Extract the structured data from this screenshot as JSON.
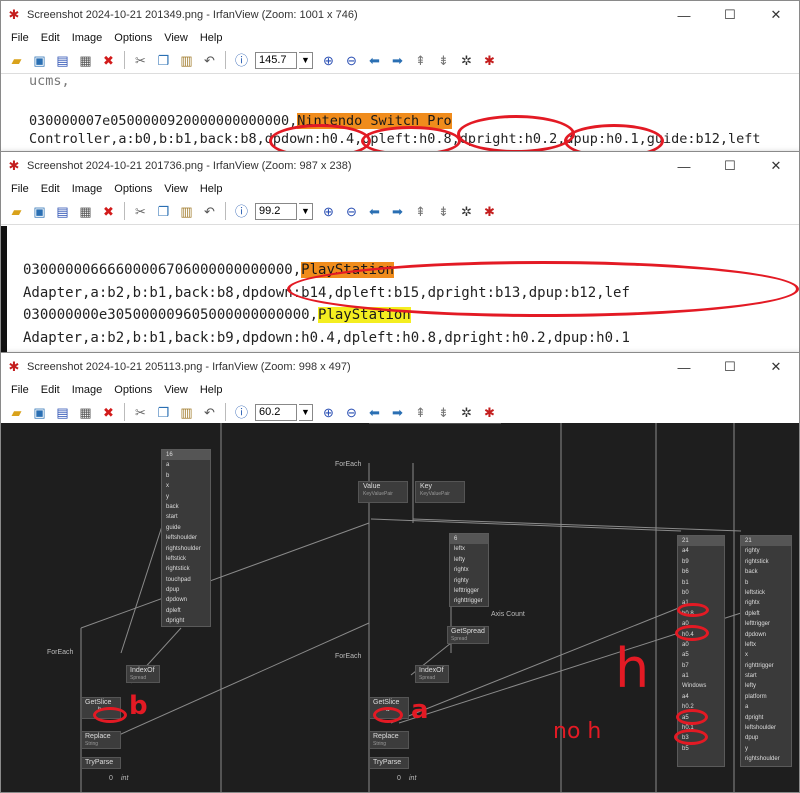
{
  "windows": [
    {
      "title": "Screenshot 2024-10-21 201349.png - IrfanView (Zoom: 1001 x 746)",
      "menu": [
        "File",
        "Edit",
        "Image",
        "Options",
        "View",
        "Help"
      ],
      "zoom": "145.7",
      "code": {
        "line0": "ucms,",
        "line1_pre": "030000007e0500000920000000000000,",
        "line1_hl": "Nintendo Switch Pro",
        "line2": "Controller,a:b0,b:b1,back:b8,dpdown:h0.4,dpleft:h0.8,dpright:h0.2,dpup:h0.1,guide:b12,left"
      }
    },
    {
      "title": "Screenshot 2024-10-21 201736.png - IrfanView (Zoom: 987 x 238)",
      "menu": [
        "File",
        "Edit",
        "Image",
        "Options",
        "View",
        "Help"
      ],
      "zoom": "99.2",
      "code": {
        "line1_pre": "03000000666600006706000000000000,",
        "line1_hl": "PlayStation",
        "line2": "Adapter,a:b2,b:b1,back:b8,dpdown:b14,dpleft:b15,dpright:b13,dpup:b12,lef",
        "line3_pre": "030000000e305000009605000000000000,",
        "line3_hl": "PlayStation",
        "line4": "Adapter,a:b2,b:b1,back:b9,dpdown:h0.4,dpleft:h0.8,dpright:h0.2,dpup:h0.1"
      }
    },
    {
      "title": "Screenshot 2024-10-21 205113.png - IrfanView (Zoom: 998 x 497)",
      "menu": [
        "File",
        "Edit",
        "Image",
        "Options",
        "View",
        "Help"
      ],
      "zoom": "60.2"
    }
  ],
  "graph": {
    "foreach_labels": [
      "ForEach",
      "ForEach",
      "ForEach"
    ],
    "value_node": {
      "title": "Value",
      "sub": "KeyValuePair"
    },
    "key_node": {
      "title": "Key",
      "sub": "KeyValuePair"
    },
    "list16": {
      "count": "16",
      "items": [
        "a",
        "b",
        "x",
        "y",
        "back",
        "start",
        "guide",
        "leftshoulder",
        "rightshoulder",
        "leftstick",
        "rightstick",
        "touchpad",
        "dpup",
        "dpdown",
        "dpleft",
        "dpright"
      ]
    },
    "list6": {
      "count": "6",
      "items": [
        "leftx",
        "lefty",
        "rightx",
        "righty",
        "lefttrigger",
        "righttrigger"
      ]
    },
    "axis_count": "Axis Count",
    "getspread": {
      "title": "GetSpread",
      "sub": "Spread"
    },
    "indexof": {
      "title": "IndexOf",
      "sub": "Spread"
    },
    "getslice": "GetSlice",
    "replace": {
      "title": "Replace",
      "sub": "String"
    },
    "tryparse": "TryParse",
    "slice_left": "b",
    "slice_mid": "a",
    "zero": "0",
    "int": "int",
    "list21a": {
      "count": "21",
      "items": [
        "a4",
        "b9",
        "b6",
        "b1",
        "b0",
        "a1",
        "h0.8",
        "a0",
        "h0.4",
        "a0",
        "a5",
        "b7",
        "a1",
        "Windows",
        "a4",
        "h0.2",
        "a5",
        "h0.1",
        "b3",
        "b5"
      ]
    },
    "list21b": {
      "count": "21",
      "items": [
        "righty",
        "rightstick",
        "back",
        "b",
        "leftstick",
        "rightx",
        "dpleft",
        "lefttrigger",
        "dpdown",
        "leftx",
        "x",
        "righttrigger",
        "start",
        "lefty",
        "platform",
        "a",
        "dpright",
        "leftshoulder",
        "dpup",
        "y",
        "rightshoulder"
      ]
    },
    "annotations": {
      "b": "b",
      "a": "a",
      "h": "h",
      "noh": "no h"
    }
  }
}
